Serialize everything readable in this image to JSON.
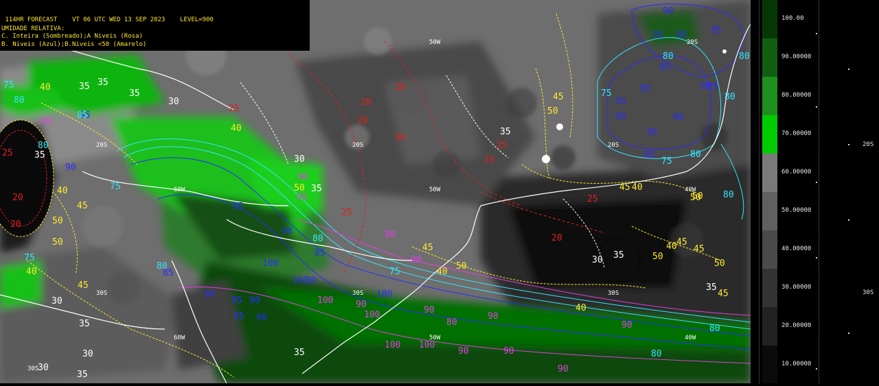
{
  "header": {
    "line1": " 114HR FORECAST    VT 06 UTC WED 13 SEP 2023    LEVEL=900",
    "line2": "UMIDADE RELATIVA:",
    "line3": "C. Inteira (Sombreado);A Niveis (Rosa)",
    "line4": "B. Niveis (Azul);B.Niveis <50 (Amarelo)"
  },
  "colors": {
    "shade_10": "#0b0b0b",
    "shade_20": "#222222",
    "shade_30": "#333333",
    "shade_40": "#4a4a4a",
    "shade_50": "#606060",
    "shade_60": "#7a7a7a",
    "shade_70": "#00cc00",
    "shade_80": "#1f8f1f",
    "shade_90": "#115e11",
    "shade_100": "#063806",
    "contour_pink": "#e040e0",
    "contour_blue": "#2b2bff",
    "contour_yellow": "#ffe830",
    "contour_red": "#e02020",
    "contour_white": "#ffffff",
    "contour_cyan": "#33e6ff"
  },
  "colorbar": {
    "labels": [
      "100.00",
      "90.00000",
      "80.00000",
      "70.00000",
      "60.00000",
      "50.00000",
      "40.00000",
      "30.00000",
      "20.00000",
      "10.00000"
    ]
  },
  "grid_labels": [
    "50W",
    "50W",
    "50W",
    "40W",
    "40W",
    "60W",
    "60W",
    "20S",
    "20S",
    "20S",
    "30S",
    "30S",
    "30S",
    "20S",
    "30S"
  ],
  "contour_labels": {
    "white": [
      "35",
      "35",
      "30",
      "35",
      "30",
      "35",
      "35",
      "30",
      "35",
      "30",
      "35",
      "30",
      "35",
      "35",
      "35",
      "35",
      "30"
    ],
    "yellow": [
      "40",
      "40",
      "45",
      "50",
      "45",
      "50",
      "40",
      "50",
      "45",
      "40",
      "50",
      "45",
      "40",
      "50",
      "45",
      "50",
      "50",
      "45",
      "50",
      "40",
      "45",
      "40",
      "50",
      "45",
      "40"
    ],
    "red": [
      "20",
      "20",
      "30",
      "25",
      "25",
      "25",
      "25",
      "20",
      "20",
      "25",
      "25",
      "20",
      "20"
    ],
    "blue": [
      "95",
      "95",
      "90",
      "85",
      "90",
      "95",
      "85",
      "85",
      "90",
      "85",
      "95",
      "90",
      "95",
      "90",
      "100",
      "100",
      "90",
      "95",
      "100",
      "90",
      "95",
      "90",
      "95",
      "90",
      "85",
      "95",
      "90",
      "85"
    ],
    "pink": [
      "100",
      "100",
      "90",
      "90",
      "90",
      "90",
      "80",
      "90",
      "100",
      "100",
      "90",
      "90",
      "80",
      "90",
      "95",
      "90",
      "95"
    ],
    "cyan": [
      "80",
      "80",
      "75",
      "80",
      "80",
      "80",
      "80",
      "80",
      "75",
      "80",
      "85",
      "75",
      "80",
      "80",
      "75",
      "80",
      "75",
      "75"
    ]
  },
  "right_labels": [
    "20S",
    "30S"
  ]
}
